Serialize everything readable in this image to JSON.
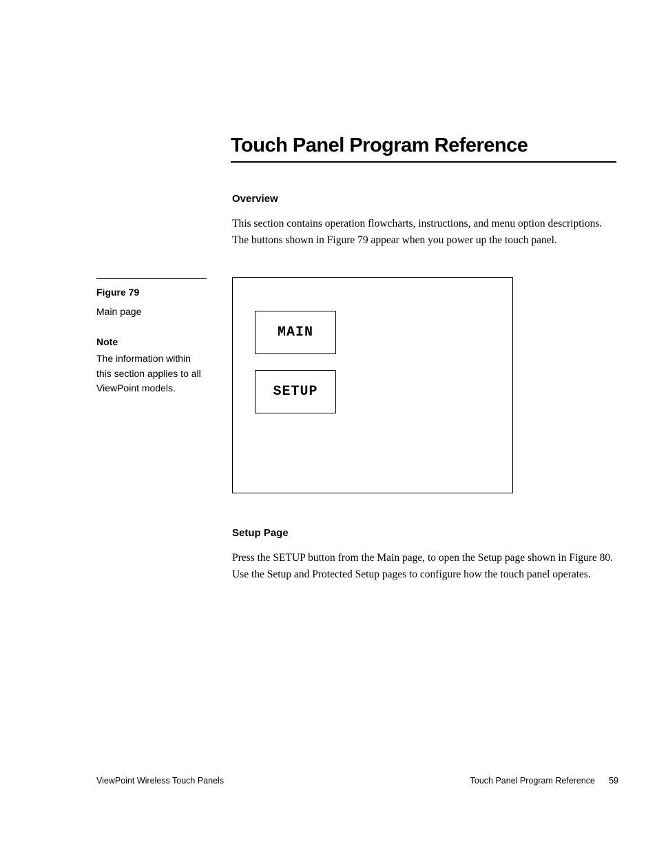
{
  "title": "Touch Panel Program Reference",
  "overview": {
    "heading": "Overview",
    "body": "This section contains operation flowcharts, instructions, and menu option descriptions. The buttons shown in Figure 79 appear when you power up the touch panel."
  },
  "sidebar": {
    "figure_label": "Figure 79",
    "figure_caption": "Main page",
    "note_label": "Note",
    "note_text": "The information within this section applies to all ViewPoint models."
  },
  "figure": {
    "buttons": {
      "main": "MAIN",
      "setup": "SETUP"
    }
  },
  "setup": {
    "heading": "Setup Page",
    "body": "Press the SETUP button from the Main page, to open the Setup page shown in Figure 80. Use the Setup and Protected Setup pages to configure how the touch panel operates."
  },
  "footer": {
    "left": "ViewPoint Wireless Touch Panels",
    "right": "Touch Panel Program Reference",
    "page": "59"
  }
}
